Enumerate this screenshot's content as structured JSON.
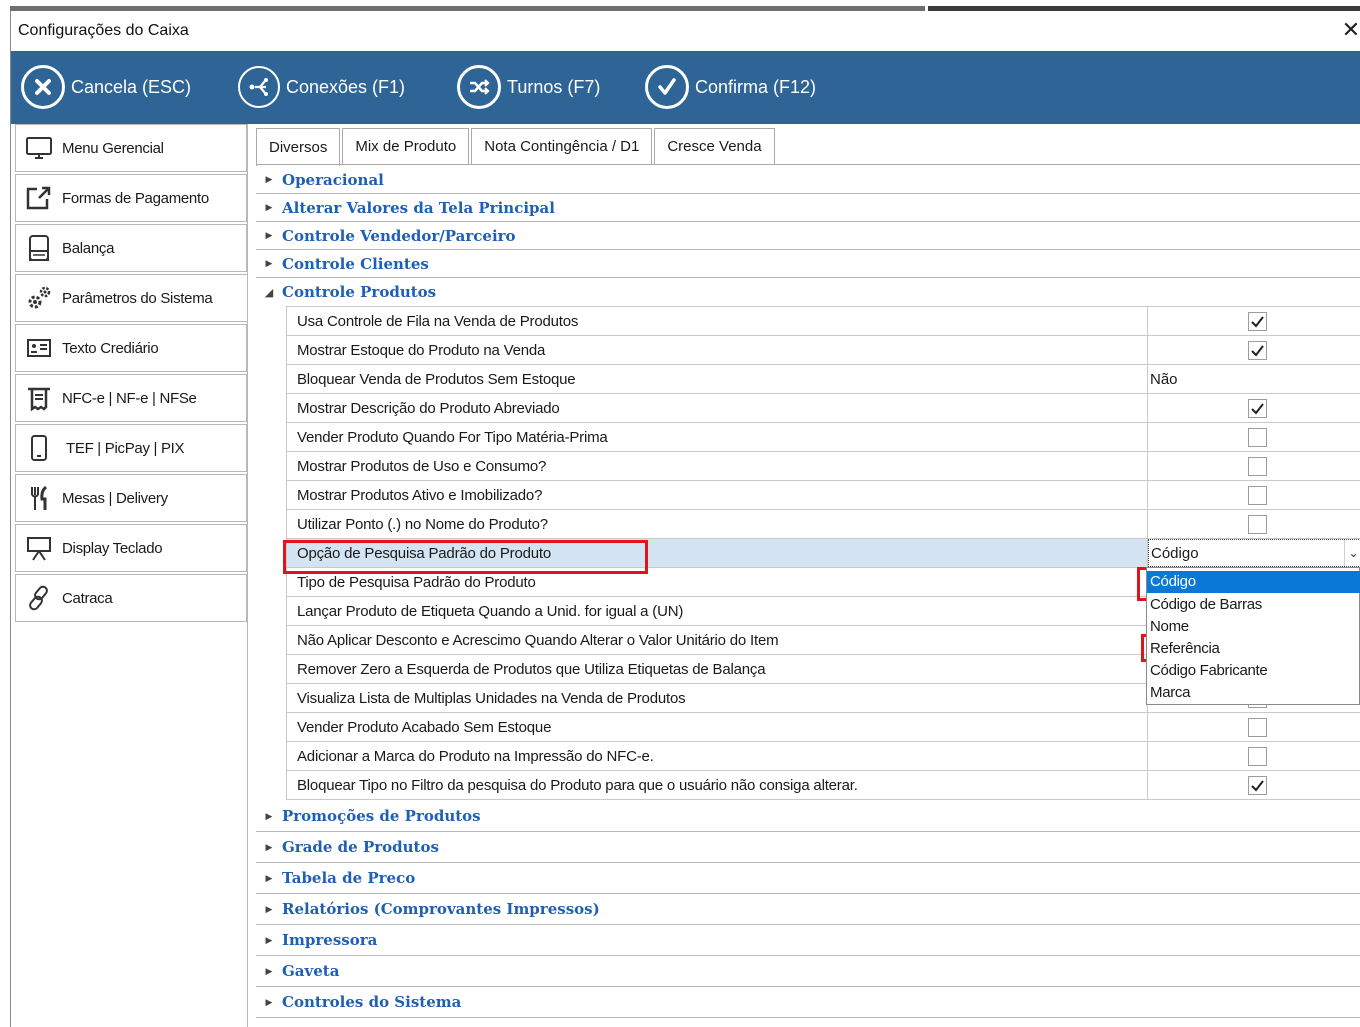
{
  "window": {
    "title": "Configurações do Caixa",
    "close_glyph": "✕"
  },
  "toolbar": {
    "buttons": [
      {
        "label": "Cancela (ESC)",
        "icon": "cancel-circle-icon"
      },
      {
        "label": "Conexões (F1)",
        "icon": "connections-icon"
      },
      {
        "label": "Turnos (F7)",
        "icon": "shuffle-icon"
      },
      {
        "label": "Confirma (F12)",
        "icon": "check-circle-icon"
      }
    ],
    "background": "#2f6497"
  },
  "sidebar": {
    "items": [
      {
        "label": "Menu Gerencial",
        "icon": "monitor-icon"
      },
      {
        "label": "Formas de Pagamento",
        "icon": "external-link-icon"
      },
      {
        "label": "Balança",
        "icon": "scale-icon"
      },
      {
        "label": "Parâmetros do Sistema",
        "icon": "gears-icon",
        "active": true
      },
      {
        "label": "Texto Crediário",
        "icon": "id-card-icon"
      },
      {
        "label": "NFC-e | NF-e | NFSe",
        "icon": "receipt-icon"
      },
      {
        "label": "TEF | PicPay | PIX",
        "icon": "phone-icon"
      },
      {
        "label": "Mesas | Delivery",
        "icon": "fork-knife-icon"
      },
      {
        "label": "Display Teclado",
        "icon": "display-icon"
      },
      {
        "label": "Catraca",
        "icon": "link-icon"
      }
    ]
  },
  "tabs": [
    {
      "label": "Diversos",
      "active": true
    },
    {
      "label": "Mix de Produto"
    },
    {
      "label": "Nota Contingência / D1"
    },
    {
      "label": "Cresce Venda"
    }
  ],
  "categories_top": [
    {
      "label": "Operacional",
      "expanded": false
    },
    {
      "label": "Alterar Valores da Tela Principal",
      "expanded": false
    },
    {
      "label": "Controle Vendedor/Parceiro",
      "expanded": false
    },
    {
      "label": "Controle Clientes",
      "expanded": false
    },
    {
      "label": "Controle Produtos",
      "expanded": true
    }
  ],
  "properties": [
    {
      "name": "Usa Controle de Fila na Venda de Produtos",
      "checked": true
    },
    {
      "name": "Mostrar Estoque do Produto na Venda",
      "checked": true
    },
    {
      "name": "Bloquear Venda de Produtos Sem Estoque",
      "value": "Não"
    },
    {
      "name": "Mostrar Descrição do Produto Abreviado",
      "checked": true
    },
    {
      "name": "Vender Produto Quando For Tipo Matéria-Prima",
      "checked": false
    },
    {
      "name": "Mostrar Produtos de Uso e Consumo?",
      "checked": false
    },
    {
      "name": "Mostrar Produtos Ativo e Imobilizado?",
      "checked": false
    },
    {
      "name": "Utilizar Ponto (.) no Nome do Produto?",
      "checked": false
    },
    {
      "name": "Opção de Pesquisa Padrão do Produto",
      "combo": "Código",
      "selected": true
    },
    {
      "name": "Tipo de Pesquisa Padrão do Produto"
    },
    {
      "name": "Lançar Produto de Etiqueta Quando a Unid. for igual a (UN)"
    },
    {
      "name": "Não Aplicar Desconto e Acrescimo Quando Alterar o Valor Unitário do Item"
    },
    {
      "name": "Remover Zero a Esquerda de Produtos que Utiliza Etiquetas de Balança"
    },
    {
      "name": "Visualiza Lista de Multiplas Unidades na Venda de Produtos",
      "checked": true
    },
    {
      "name": "Vender Produto Acabado Sem Estoque",
      "checked": false
    },
    {
      "name": "Adicionar a Marca do Produto na Impressão do NFC-e.",
      "checked": false
    },
    {
      "name": "Bloquear Tipo no Filtro da pesquisa do Produto para que o usuário não consiga alterar.",
      "checked": true
    }
  ],
  "dropdown": {
    "options": [
      "Código",
      "Código de Barras",
      "Nome",
      "Referência",
      "Código Fabricante",
      "Marca"
    ],
    "selected": "Código",
    "highlight_color": "#0a78d7"
  },
  "categories_bottom": [
    {
      "label": "Promoções de Produtos"
    },
    {
      "label": "Grade de Produtos"
    },
    {
      "label": "Tabela de Preco"
    },
    {
      "label": "Relatórios (Comprovantes Impressos)"
    },
    {
      "label": "Impressora"
    },
    {
      "label": "Gaveta"
    },
    {
      "label": "Controles do Sistema"
    }
  ],
  "colors": {
    "category_text": "#1f5fb5",
    "annotation_red": "#e0151c",
    "selected_row": "#d5e4f2"
  }
}
